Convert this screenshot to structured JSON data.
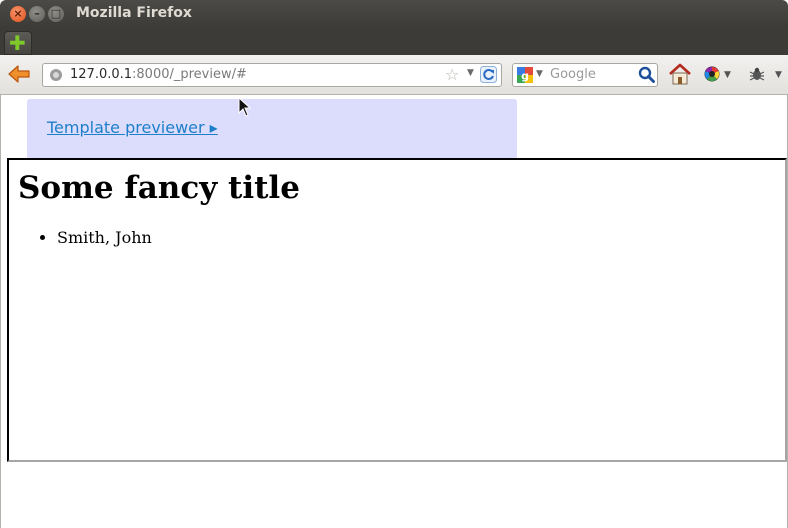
{
  "window": {
    "title": "Mozilla Firefox",
    "buttons": {
      "close": "×",
      "minimize": "–",
      "maximize": "□"
    }
  },
  "tabstrip": {
    "new_tab_icon": "plus-icon"
  },
  "toolbar": {
    "url_host": "127.0.0.1",
    "url_rest": ":8000/_preview/#",
    "search_placeholder": "Google",
    "icons": [
      "back-arrow-icon",
      "site-identity-icon",
      "star-icon",
      "reload-icon",
      "google-icon",
      "magnifier-icon",
      "home-icon",
      "color-wheel-icon",
      "bug-icon"
    ]
  },
  "page": {
    "preview_link": "Template previewer ▸",
    "heading": "Some fancy title",
    "list_items": [
      "Smith, John"
    ]
  },
  "colors": {
    "titlebar": "#3c3b37",
    "preview_bar": "#dcdcfc",
    "link": "#1d7fc9",
    "back_arrow": "#e8761a"
  }
}
